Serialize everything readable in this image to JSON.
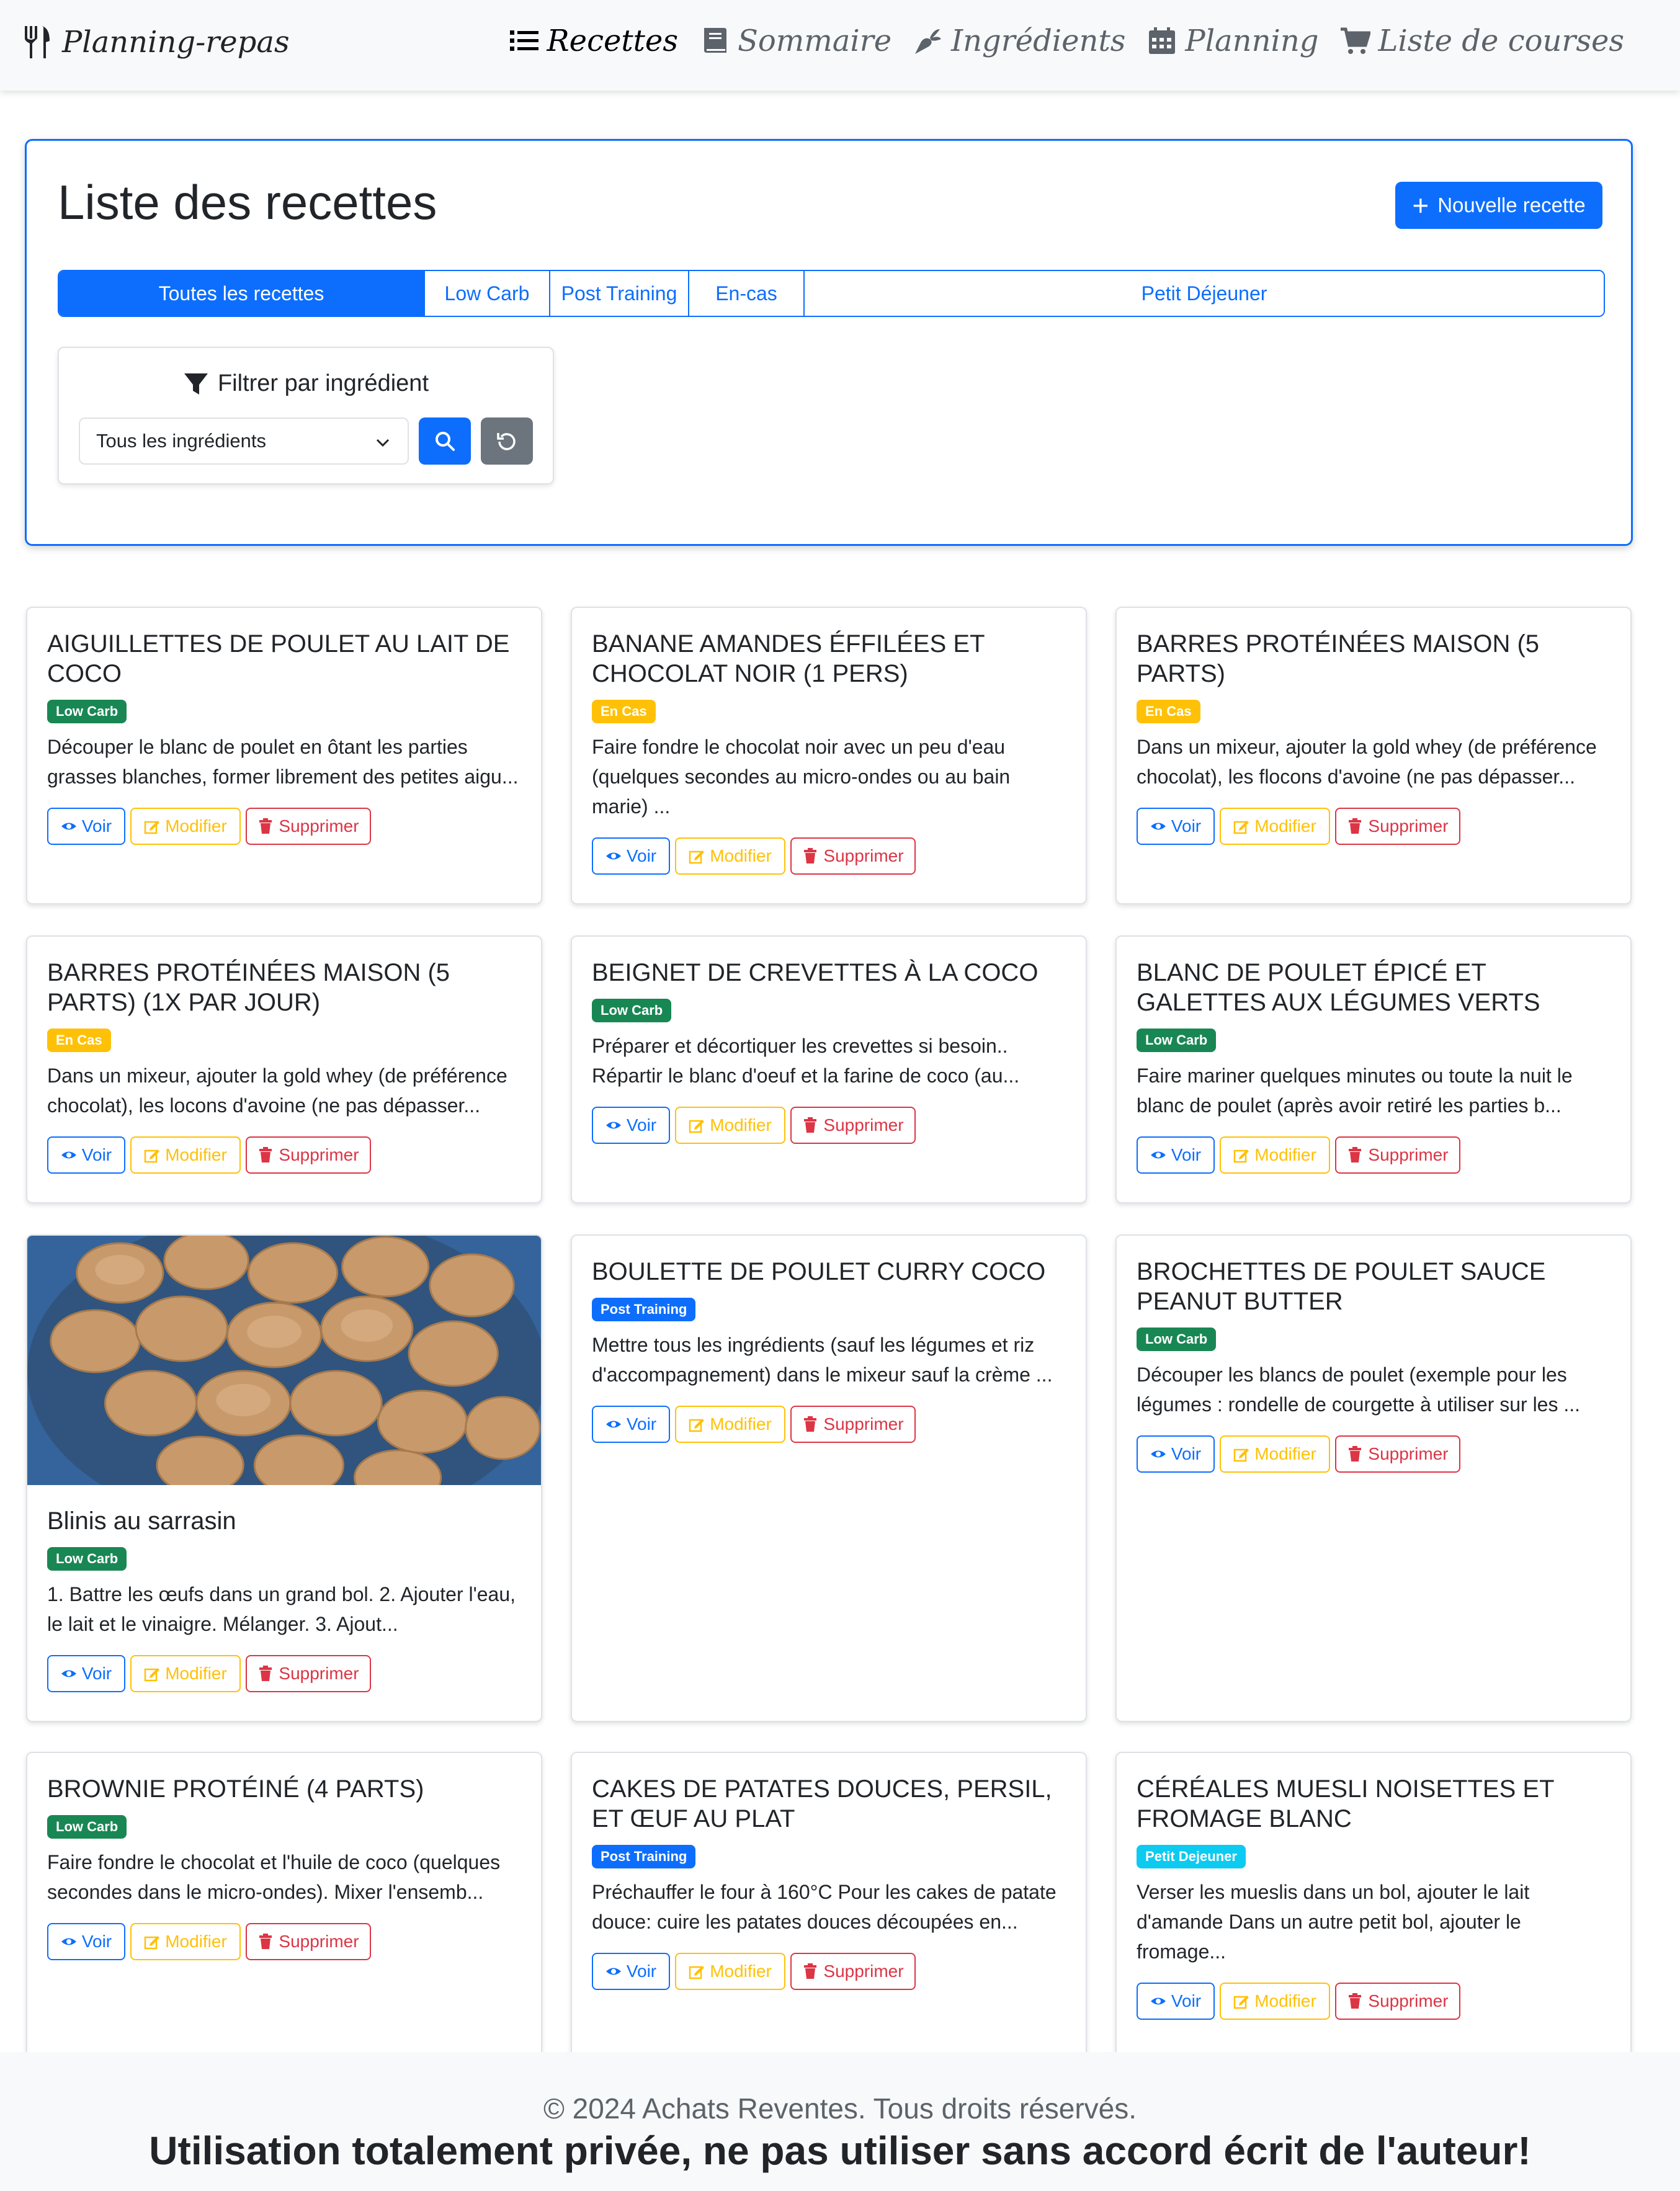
{
  "brand": {
    "name": "Planning-repas",
    "icon": "utensils-icon"
  },
  "nav": [
    {
      "label": "Recettes",
      "icon": "list-icon",
      "active": true
    },
    {
      "label": "Sommaire",
      "icon": "book-icon",
      "active": false
    },
    {
      "label": "Ingrédients",
      "icon": "carrot-icon",
      "active": false
    },
    {
      "label": "Planning",
      "icon": "calendar-icon",
      "active": false
    },
    {
      "label": "Liste de courses",
      "icon": "cart-icon",
      "active": false
    }
  ],
  "header": {
    "title": "Liste des recettes",
    "new_button": "Nouvelle recette"
  },
  "tabs": [
    {
      "label": "Toutes les recettes",
      "active": true
    },
    {
      "label": "Low Carb",
      "active": false
    },
    {
      "label": "Post Training",
      "active": false
    },
    {
      "label": "En-cas",
      "active": false
    },
    {
      "label": "Petit Déjeuner",
      "active": false
    }
  ],
  "filter": {
    "title": "Filtrer par ingrédient",
    "selected": "Tous les ingrédients"
  },
  "actions": {
    "view": "Voir",
    "edit": "Modifier",
    "delete": "Supprimer"
  },
  "colors": {
    "primary": "#0d6efd",
    "low_carb": "#198754",
    "en_cas": "#ffc107",
    "petit_dejeuner": "#0dcaf0",
    "danger": "#dc3545",
    "secondary": "#6c757d"
  },
  "recipes": [
    {
      "title": "AIGUILLETTES DE POULET AU LAIT DE COCO",
      "badge": "Low Carb",
      "text": "Découper le blanc de poulet en ôtant les parties grasses blanches, former librement des petites aigu..."
    },
    {
      "title": "BANANE AMANDES ÉFFILÉES ET CHOCOLAT NOIR (1 PERS)",
      "badge": "En Cas",
      "text": "Faire fondre le chocolat noir avec un peu d'eau (quelques secondes au micro-ondes ou au bain marie) ..."
    },
    {
      "title": "BARRES PROTÉINÉES MAISON (5 PARTS)",
      "badge": "En Cas",
      "text": "Dans un mixeur, ajouter la gold whey (de préférence chocolat), les flocons d'avoine (ne pas dépasser..."
    },
    {
      "title": "BARRES PROTÉINÉES MAISON (5 PARTS) (1X PAR JOUR)",
      "badge": "En Cas",
      "text": "Dans un mixeur, ajouter la gold whey (de préférence chocolat), les locons d'avoine (ne pas dépasser..."
    },
    {
      "title": "BEIGNET DE CREVETTES À LA COCO",
      "badge": "Low Carb",
      "text": "Préparer et décortiquer les crevettes si besoin.. Répartir le blanc d'oeuf et la farine de coco (au..."
    },
    {
      "title": "BLANC DE POULET ÉPICÉ ET GALETTES AUX LÉGUMES VERTS",
      "badge": "Low Carb",
      "text": "Faire mariner quelques minutes ou toute la nuit le blanc de poulet (après avoir retiré les parties b..."
    },
    {
      "title": "Blinis au sarrasin",
      "badge": "Low Carb",
      "text": "1. Battre les œufs dans un grand bol. 2. Ajouter l'eau, le lait et le vinaigre. Mélanger. 3. Ajout..."
    },
    {
      "title": "BOULETTE DE POULET CURRY COCO",
      "badge": "Post Training",
      "text": "Mettre tous les ingrédients (sauf les légumes et riz d'accompagnement) dans le mixeur sauf la crème ..."
    },
    {
      "title": "BROCHETTES DE POULET SAUCE PEANUT BUTTER",
      "badge": "Low Carb",
      "text": "Découper les blancs de poulet (exemple pour les légumes : rondelle de courgette à utiliser sur les ..."
    },
    {
      "title": "BROWNIE PROTÉINÉ (4 PARTS)",
      "badge": "Low Carb",
      "text": "Faire fondre le chocolat et l'huile de coco (quelques secondes dans le micro-ondes). Mixer l'ensemb..."
    },
    {
      "title": "CAKES DE PATATES DOUCES, PERSIL, ET ŒUF AU PLAT",
      "badge": "Post Training",
      "text": "Préchauffer le four à 160°C Pour les cakes de patate douce: cuire les patates douces découpées en..."
    },
    {
      "title": "CÉRÉALES MUESLI NOISETTES ET FROMAGE BLANC",
      "badge": "Petit Dejeuner",
      "text": "Verser les mueslis dans un bol, ajouter le lait d'amande Dans un autre petit bol, ajouter le fromage..."
    }
  ],
  "footer": {
    "copyright": "© 2024 Achats Reventes. Tous droits réservés.",
    "warning": "Utilisation totalement privée, ne pas utiliser sans accord écrit de l'auteur!"
  }
}
